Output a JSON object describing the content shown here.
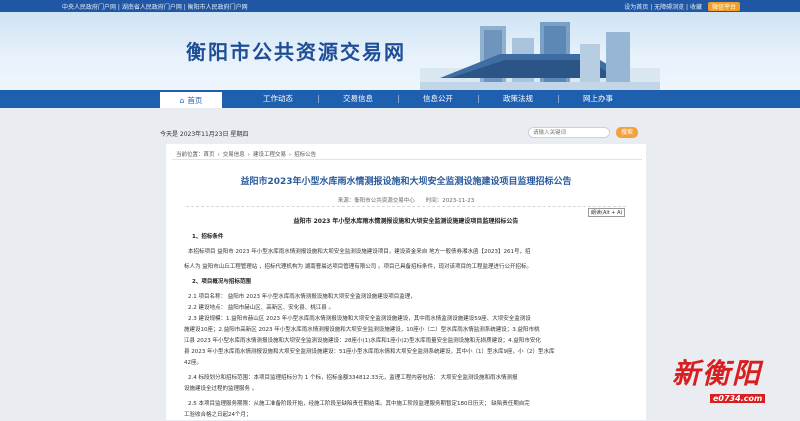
{
  "topbar": {
    "left": "中央人民政府门户网 | 湖南省人民政府门户网 | 衡阳市人民政府门户网",
    "right": "设为首页 | 无障碍浏览 | 收藏",
    "wx": "微信平台"
  },
  "header": {
    "site_title": "衡阳市公共资源交易网"
  },
  "nav": {
    "items": [
      "首页",
      "工作动态",
      "交易信息",
      "信息公开",
      "政策法规",
      "网上办事"
    ]
  },
  "datebar": {
    "date": "今天是 2023年11月23日 星期四",
    "search_placeholder": "请输入关键词",
    "search_btn": "搜索"
  },
  "breadcrumb": {
    "label": "当前位置：",
    "items": [
      "首页",
      "交易信息",
      "建设工程交易",
      "招标公告"
    ]
  },
  "article": {
    "title": "益阳市2023年小型水库雨水情测报设施和大坝安全监测设施建设项目监理招标公告",
    "source": "来源：衡阳市公共资源交易中心　　时间：2023-11-23",
    "read_btn": "朗读(Alt + A)",
    "subtitle": "益阳市 2023 年小型水库雨水情测报设施和大坝安全监测设施建设项目监理招标公告",
    "lines": [
      {
        "t": "1、招标条件",
        "sec": true
      },
      {
        "t": "本招标项目 益阳市 2023 年小型水库雨水情测报设施和大坝安全监测设施建设项目，建设资金来自 地方一般债券湘水函【2023】261号，招"
      },
      {
        "t": "标人为 益阳市山丘工程管理站 ，招标代理机构为 湖南曹晨达项目管理有限公司 。项目已具备招标条件，现对该项目的工程监理进行公开招标。"
      },
      {
        "t": "2、项目概况与招标范围",
        "sec": true
      },
      {
        "t": "2.1 项目名称： 益阳市 2023 年小型水库雨水情测报设施和大坝安全监测设施建设项目监理，"
      },
      {
        "t": "2.2 建设地点： 益阳市赫山区、高新区、安化县、桃江县 。"
      },
      {
        "t": "2.3 建设规模：1.益阳市赫山区 2023 年小型水库雨水情测报设施和大坝安全监测设施建设，其中雨水情监测设施建设59座、大坝安全监测设"
      },
      {
        "t": "施建设10座；2.益阳市高新区 2023 年小型水库雨水情测报设施和大坝安全监测设施建设，10座小（二）型水库雨水情监测系统建设；3.益阳市桃"
      },
      {
        "t": "江县 2023 年小型水库雨水情测报设施和大坝安全监测设施建设：28座小(1)水库和1座小(2)型水库雨量安全监测设施和无损质建设；4.益阳市安化"
      },
      {
        "t": "县 2023 年小型水库雨水情测报设施和大坝安全监测设施建设：51座小型水库雨水情和大坝安全监测系统建设，其中小（1）型水库9座，小（2）型水库"
      },
      {
        "t": "42座。"
      },
      {
        "t": "2.4 标段划分和招标范围：本项目监理招标分为 1 个标，招标金额334812.33元，监理工程内容包括： 大坝安全监测设施和雨水情测报"
      },
      {
        "t": "设施建设全过程的监理服务 。"
      },
      {
        "t": "2.5 本项目监理服务期限：从施工准备阶段开始，经施工阶段至缺陷责任期结束。其中施工阶段监理服务期暂定180日历天； 缺陷责任期自完"
      },
      {
        "t": "工验收合格之日起24个月；"
      }
    ]
  },
  "watermark": {
    "text": "新衡阳",
    "url": "e0734.com"
  },
  "colors": {
    "nav": "#1f5fb0",
    "title": "#2a5a9a",
    "search_btn": "#f2a13b",
    "logo": "#d81e1e"
  }
}
